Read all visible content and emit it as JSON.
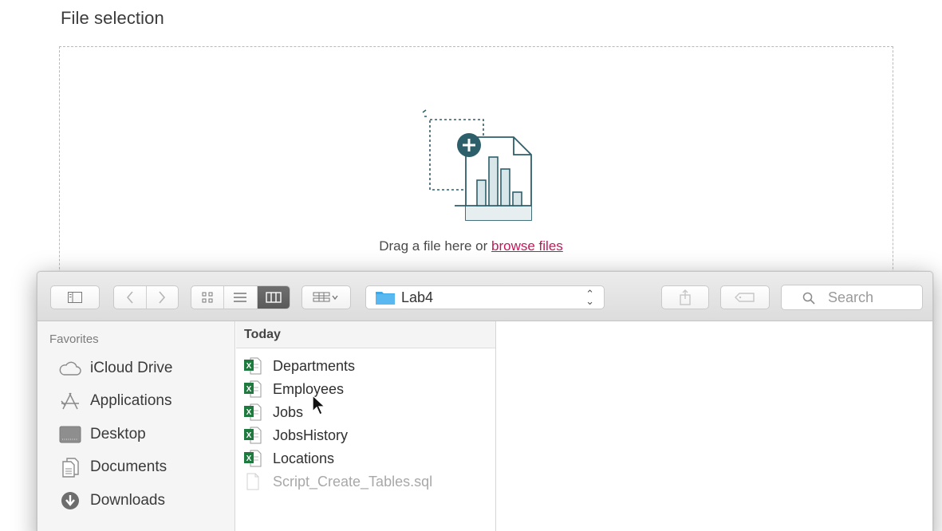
{
  "section": {
    "title": "File selection"
  },
  "dropzone": {
    "prompt": "Drag a file here or",
    "browse_link": "browse files"
  },
  "finder": {
    "toolbar": {
      "location": "Lab4",
      "search_placeholder": "Search",
      "icons": [
        "sidebar-toggle-icon",
        "back-icon",
        "forward-icon",
        "icon-view-icon",
        "list-view-icon",
        "column-view-icon",
        "arrange-icon",
        "share-icon",
        "tag-icon",
        "search-icon"
      ]
    },
    "sidebar": {
      "heading": "Favorites",
      "items": [
        {
          "label": "iCloud Drive",
          "icon": "cloud-icon"
        },
        {
          "label": "Applications",
          "icon": "applications-icon"
        },
        {
          "label": "Desktop",
          "icon": "desktop-icon"
        },
        {
          "label": "Documents",
          "icon": "documents-icon"
        },
        {
          "label": "Downloads",
          "icon": "downloads-icon"
        }
      ]
    },
    "column": {
      "header": "Today",
      "files": [
        {
          "name": "Departments",
          "type": "excel",
          "enabled": true
        },
        {
          "name": "Employees",
          "type": "excel",
          "enabled": true
        },
        {
          "name": "Jobs",
          "type": "excel",
          "enabled": true
        },
        {
          "name": "JobsHistory",
          "type": "excel",
          "enabled": true
        },
        {
          "name": "Locations",
          "type": "excel",
          "enabled": true
        },
        {
          "name": "Script_Create_Tables.sql",
          "type": "sql",
          "enabled": false
        }
      ]
    }
  },
  "colors": {
    "accent_link": "#c2185b",
    "illustration_teal": "#2d5f6b",
    "folder_blue": "#3fa7e6",
    "excel_green": "#1f7a3f"
  }
}
